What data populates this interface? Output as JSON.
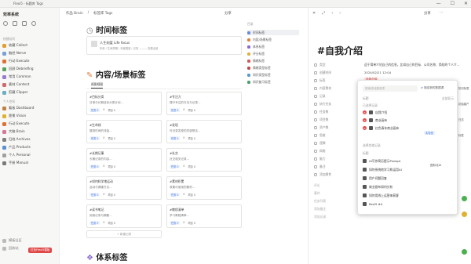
{
  "window": {
    "title": "Flexi5 - 标题库 Tags",
    "controls": [
      "—",
      "☐",
      "✕"
    ]
  },
  "sidebar": {
    "workspace": "效率系统",
    "section1": "快捷访问",
    "items1": [
      {
        "label": "收藏 Collect",
        "color": "#e0a030"
      },
      {
        "label": "脑经 Nerve",
        "color": "#7aa0d8"
      },
      {
        "label": "行动 Execute",
        "color": "#e07030"
      },
      {
        "label": "回顾 Debriefing",
        "color": "#5aa060"
      },
      {
        "label": "常用 Common",
        "color": "#9a7ad0"
      },
      {
        "label": "素材 Content",
        "color": "#d06a6a"
      },
      {
        "label": "剪藏 Clipper",
        "color": "#6ab0c0"
      }
    ],
    "section2": "个人空间",
    "items2": [
      {
        "label": "看板 Dashboard",
        "color": "#c08040"
      },
      {
        "label": "愿景 Vision",
        "color": "#e0b030"
      },
      {
        "label": "行动 Execute",
        "color": "#e07030"
      },
      {
        "label": "大脑 Brain",
        "color": "#d07a9a"
      },
      {
        "label": "归档 Archives",
        "color": "#808080"
      },
      {
        "label": "产品 Products",
        "color": "#5a90d0"
      },
      {
        "label": "个人 Personal",
        "color": "#a0a0a0"
      },
      {
        "label": "手册 Manual",
        "color": "#7a7a7a"
      }
    ],
    "bottom1": "模板社区",
    "bottom2": "回收站",
    "badge": "红色Flexi5模板"
  },
  "main": {
    "breadcrumb1": "作品 Brain",
    "breadcrumb2": "标签库 Tags",
    "share": "分享",
    "h1": "时间标签",
    "h2": "内容/场景标签",
    "h3": "体系标签",
    "tab": "视图视图",
    "life_title": "人生刻度 Life focus",
    "life_sub": "年龄 / 生命周期 / 年度展望 / 记录 ——— 查看全部",
    "tags": [
      {
        "name": "#目标分类",
        "desc": "日常与长期目标分类计划…",
        "m1": "任务 0",
        "m2": "0",
        "m3": "项目 0"
      },
      {
        "name": "#专注力",
        "desc": "提升专注的方法与记录…",
        "m1": "任务 0",
        "m2": "0",
        "m3": "项目 0"
      },
      {
        "name": "#生命线",
        "desc": "展现时间的流逝…",
        "m1": "任务 0",
        "m2": "0",
        "m3": "项目 0"
      },
      {
        "name": "#发现",
        "desc": "可记录发现的灵感想法…",
        "m1": "任务 0",
        "m2": "0",
        "m3": "项目 0"
      },
      {
        "name": "#长期记事",
        "desc": "长期记录的内容…",
        "m1": "任务 0",
        "m2": "0",
        "m3": "项目 0"
      },
      {
        "name": "#社交",
        "desc": "社交相关记录…",
        "m1": "任务 0",
        "m2": "0",
        "m3": "项目 0"
      },
      {
        "name": "#如何科学地运动",
        "desc": "运动与健康方法…",
        "m1": "任务 0",
        "m2": "0",
        "m3": "项目 0"
      },
      {
        "name": "#素材积累",
        "desc": "收集可使用的素材…",
        "m1": "任务 0",
        "m2": "0",
        "m3": "项目 0"
      },
      {
        "name": "#读书笔记",
        "desc": "阅读记录与摘要…",
        "m1": "任务 0",
        "m2": "0",
        "m3": "项目 0"
      },
      {
        "name": "#教程清单",
        "desc": "学习教程清单…",
        "m1": "任务 0",
        "m2": "0",
        "m3": "项目 0"
      }
    ],
    "new_label": "+ 新建记录"
  },
  "toc": {
    "title": "目录",
    "items": [
      {
        "label": "时间标签",
        "color": "#6a8adc"
      },
      {
        "label": "内容/场景标签",
        "color": "#e08040"
      },
      {
        "label": "体系标签",
        "color": "#8a6ad0"
      },
      {
        "label": "评分标签",
        "color": "#e0b040"
      },
      {
        "label": "情绪标签",
        "color": "#d05a5a"
      },
      {
        "label": "情绪类型标签",
        "color": "#c04a4a"
      },
      {
        "label": "知识类型标签",
        "color": "#5a9ad0"
      },
      {
        "label": "知识复习标签",
        "color": "#4aa06a"
      }
    ]
  },
  "right": {
    "share": "分享",
    "title": "#自我介绍",
    "props": [
      {
        "k": "类型",
        "v": "适于简单介绍自己的信息，比如自己的目标、公司名称、简短的个人介绍等"
      },
      {
        "k": "创建时间",
        "v": "2024/02/21 12:04"
      },
      {
        "k": "标签",
        "v": "自我介绍"
      },
      {
        "k": "内容素材",
        "v": ""
      },
      {
        "k": "记录",
        "v": ""
      },
      {
        "k": "执行任务",
        "v": ""
      },
      {
        "k": "任务数",
        "v": ""
      },
      {
        "k": "项目数",
        "v": ""
      },
      {
        "k": "资产数",
        "v": ""
      },
      {
        "k": "思维",
        "v": ""
      },
      {
        "k": "逻辑",
        "v": ""
      },
      {
        "k": "网络",
        "v": ""
      },
      {
        "k": "脑力",
        "v": ""
      },
      {
        "k": "备注",
        "v": ""
      },
      {
        "k": "添加属性",
        "v": ""
      }
    ],
    "right_snippets": [
      "知识标签",
      "初始客户",
      "日志",
      "标签"
    ],
    "comment": "评论",
    "below": [
      "事件",
      "任务列表",
      "添加备注",
      "添加记录"
    ]
  },
  "popup": {
    "search": "搜索或创建选项",
    "link_label": "指定新的数据源",
    "header_name": "标题",
    "header_act": "全部显示",
    "section1": "已选择记录",
    "sel": [
      "自我介绍",
      "商业画布",
      "红色青年商业画布"
    ],
    "sel_badge": "实验室",
    "section2": "选择其他记录",
    "header2": "标题",
    "other": [
      "AI写作简历提示Prompt",
      "如何系统地学习和运用AI",
      "用户问题回复",
      "商业画布如何分析",
      "如何用线上运营来获客",
      "flexi5 #4"
    ],
    "other_right": [
      "国际化AI"
    ]
  },
  "colors": {
    "accent": "#e04848",
    "link": "#3a6fd8"
  }
}
